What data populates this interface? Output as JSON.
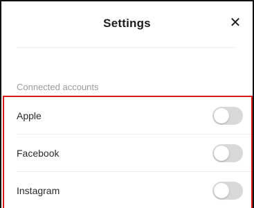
{
  "header": {
    "title": "Settings",
    "close_icon": "close-icon"
  },
  "section": {
    "label": "Connected accounts"
  },
  "accounts": [
    {
      "label": "Apple",
      "enabled": false
    },
    {
      "label": "Facebook",
      "enabled": false
    },
    {
      "label": "Instagram",
      "enabled": false
    }
  ],
  "colors": {
    "highlight_border": "#d61a1a",
    "toggle_off": "#d9d9d9",
    "section_label": "#9a9a9a"
  }
}
